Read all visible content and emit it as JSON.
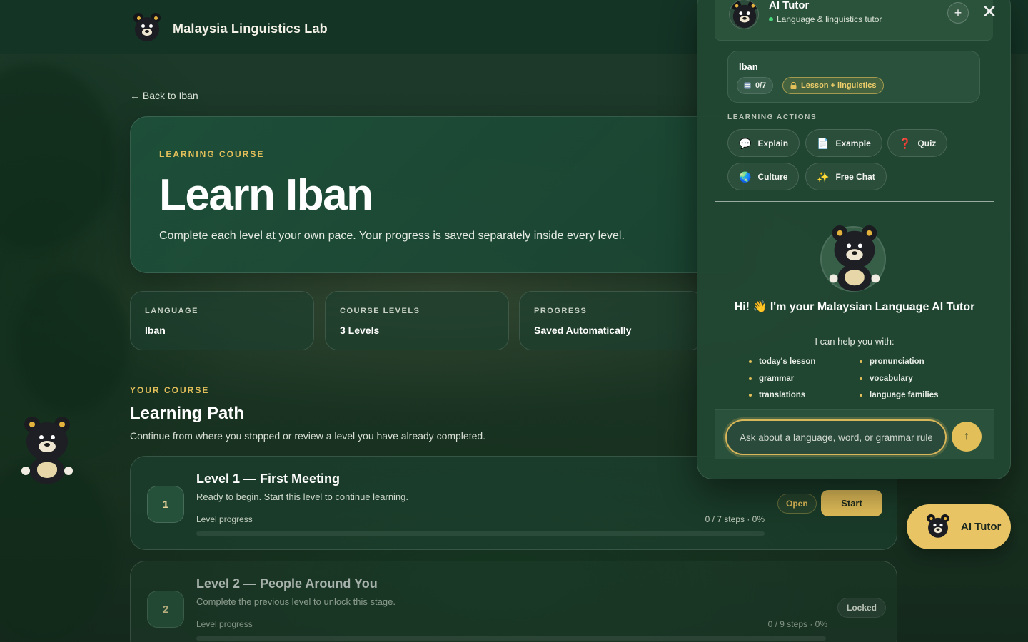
{
  "topbar": {
    "brand": "Malaysia Linguistics Lab"
  },
  "back_link": "← Back to Iban",
  "hero": {
    "eyebrow": "LEARNING COURSE",
    "title": "Learn Iban",
    "description": "Complete each level at your own pace. Your progress is saved separately inside every level."
  },
  "info_cards": [
    {
      "label": "LANGUAGE",
      "value": "Iban"
    },
    {
      "label": "COURSE LEVELS",
      "value": "3 Levels"
    },
    {
      "label": "PROGRESS",
      "value": "Saved Automatically"
    }
  ],
  "course": {
    "eyebrow": "YOUR COURSE",
    "title": "Learning Path",
    "subtitle": "Continue from where you stopped or review a level you have already completed."
  },
  "levels": [
    {
      "number": "1",
      "title": "Level 1 — First Meeting",
      "description": "Ready to begin. Start this level to continue learning.",
      "progress_label": "Level progress",
      "steps": "0 / 7 steps · 0%",
      "progress": 0,
      "status": "Open",
      "action": "Start"
    },
    {
      "number": "2",
      "title": "Level 2 — People Around You",
      "description": "Complete the previous level to unlock this stage.",
      "progress_label": "Level progress",
      "steps": "0 / 9 steps · 0%",
      "progress": 0,
      "status": "Locked"
    }
  ],
  "tutor": {
    "title": "AI Tutor",
    "status": "Language & linguistics tutor",
    "plus_icon": "+",
    "close_icon": "✕",
    "context": {
      "title": "Iban",
      "count": "0/7",
      "lesson_chip": "Lesson + linguistics"
    },
    "actions_heading": "LEARNING ACTIONS",
    "actions": [
      {
        "icon": "💬",
        "label": "Explain"
      },
      {
        "icon": "📄",
        "label": "Example"
      },
      {
        "icon": "❓",
        "label": "Quiz"
      },
      {
        "icon": "🌏",
        "label": "Culture"
      },
      {
        "icon": "✨",
        "label": "Free Chat"
      }
    ],
    "welcome": {
      "title": "Hi! 👋 I'm your Malaysian Language AI Tutor",
      "subtitle": "I can help you with:",
      "help_items": [
        "today's lesson",
        "pronunciation",
        "grammar",
        "vocabulary",
        "translations",
        "language families"
      ]
    },
    "input_placeholder": "Ask about a language, word, or grammar rule...",
    "send_icon": "↑"
  },
  "fab": {
    "label": "AI Tutor"
  },
  "colors": {
    "accent": "#e3bf5a",
    "panel": "#214632",
    "status_online": "#49d67b"
  }
}
